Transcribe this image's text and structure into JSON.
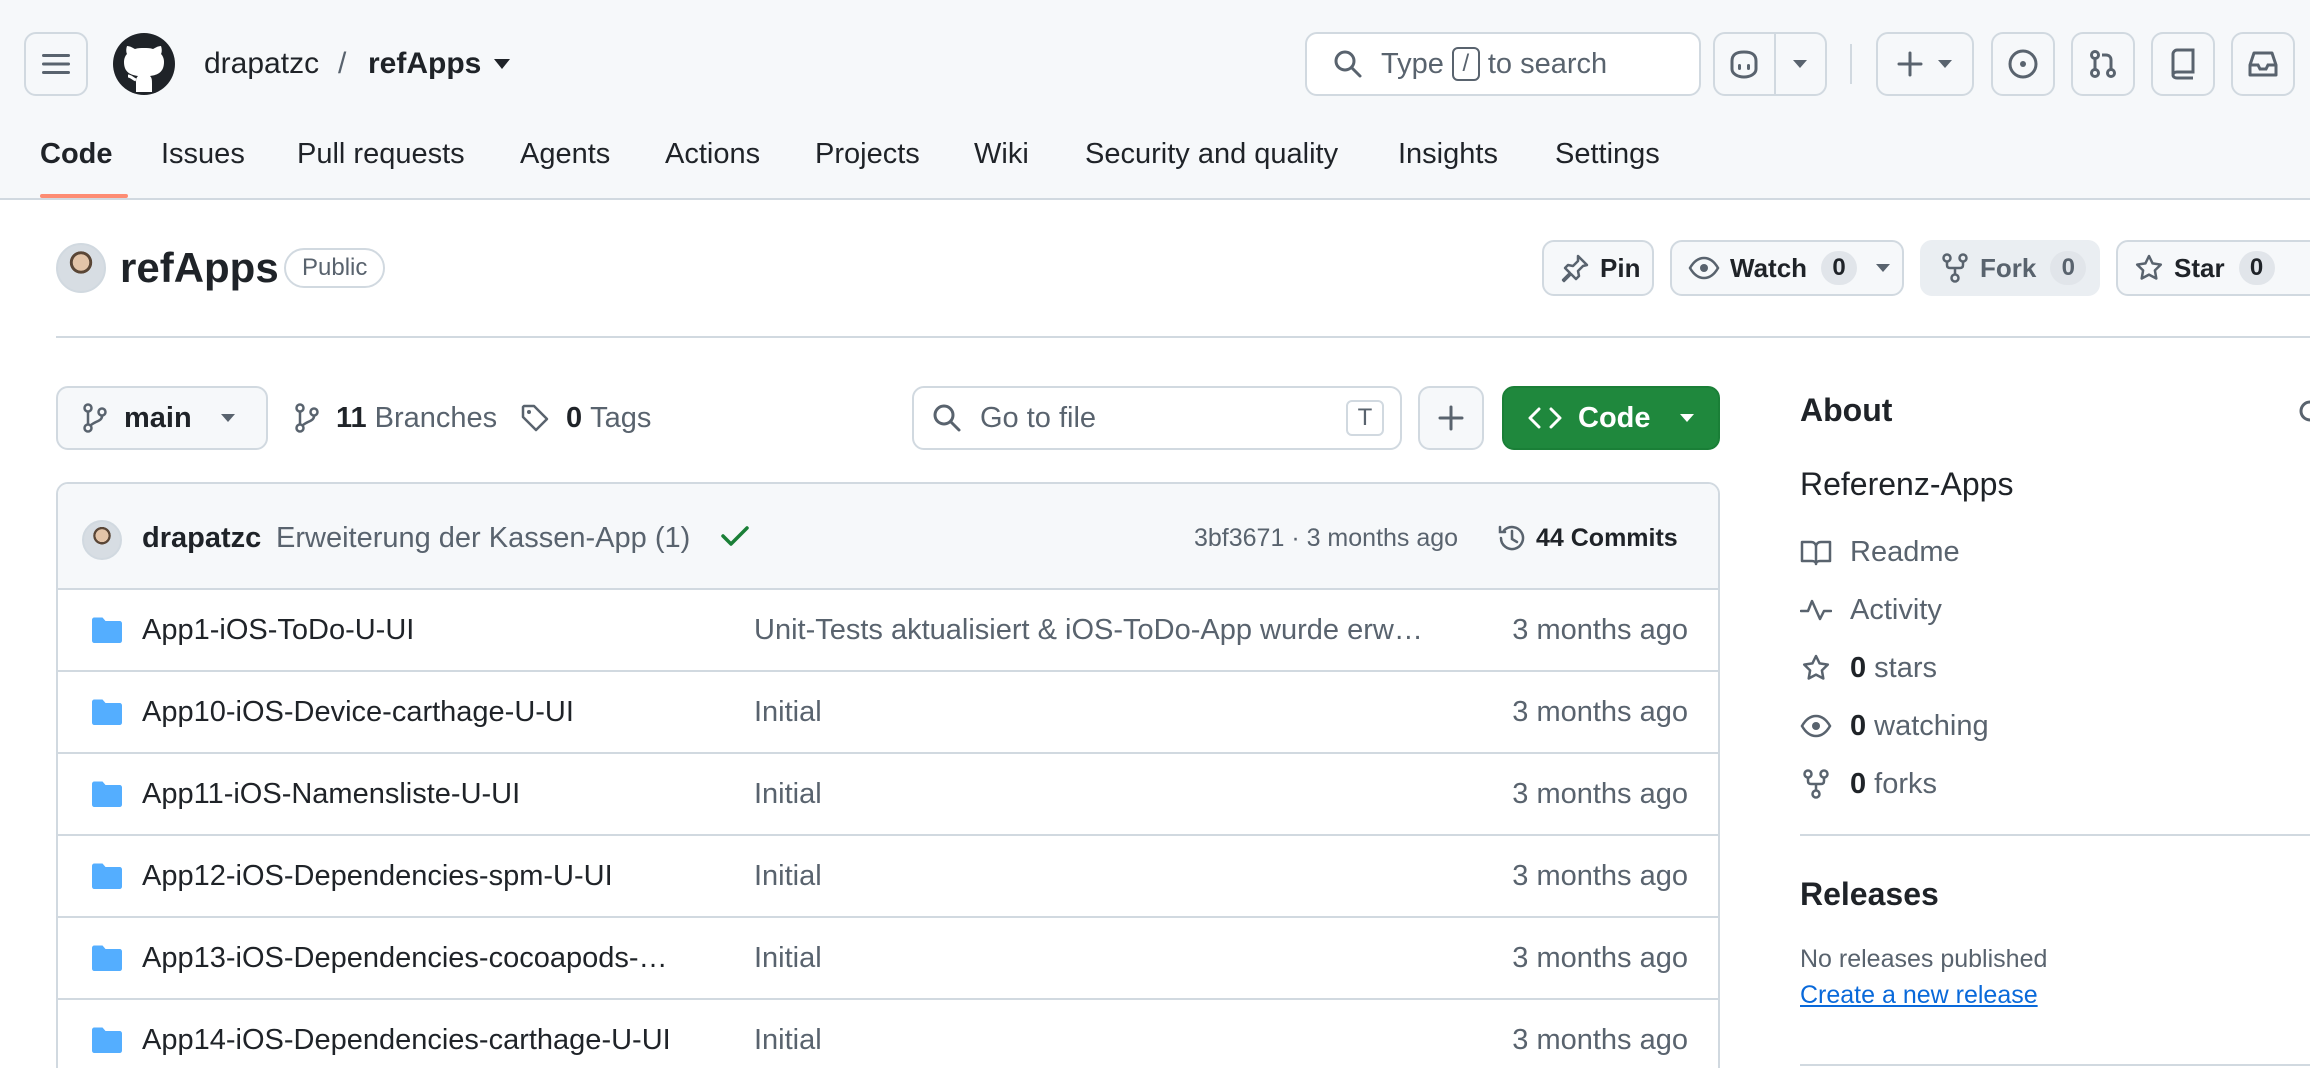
{
  "header": {
    "owner": "drapatzc",
    "separator": "/",
    "repo": "refApps",
    "search_prefix": "Type",
    "search_key": "/",
    "search_suffix": "to search"
  },
  "tabs": [
    {
      "label": "Code"
    },
    {
      "label": "Issues"
    },
    {
      "label": "Pull requests"
    },
    {
      "label": "Agents"
    },
    {
      "label": "Actions"
    },
    {
      "label": "Projects"
    },
    {
      "label": "Wiki"
    },
    {
      "label": "Security and quality"
    },
    {
      "label": "Insights"
    },
    {
      "label": "Settings"
    }
  ],
  "repo_header": {
    "title": "refApps",
    "visibility": "Public",
    "pin_label": "Pin",
    "watch_label": "Watch",
    "watch_count": "0",
    "fork_label": "Fork",
    "fork_count": "0",
    "star_label": "Star",
    "star_count": "0"
  },
  "controls": {
    "branch": "main",
    "branches_count": "11",
    "branches_label": "Branches",
    "tags_count": "0",
    "tags_label": "Tags",
    "goto_placeholder": "Go to file",
    "goto_key": "T",
    "code_label": "Code"
  },
  "commit": {
    "author": "drapatzc",
    "message": "Erweiterung der Kassen-App (1)",
    "hash_time": "3bf3671 · 3 months ago",
    "commits_label": "44 Commits"
  },
  "files": [
    {
      "name": "App1-iOS-ToDo-U-UI",
      "message": "Unit-Tests aktualisiert & iOS-ToDo-App wurde erw…",
      "date": "3 months ago"
    },
    {
      "name": "App10-iOS-Device-carthage-U-UI",
      "message": "Initial",
      "date": "3 months ago"
    },
    {
      "name": "App11-iOS-Namensliste-U-UI",
      "message": "Initial",
      "date": "3 months ago"
    },
    {
      "name": "App12-iOS-Dependencies-spm-U-UI",
      "message": "Initial",
      "date": "3 months ago"
    },
    {
      "name": "App13-iOS-Dependencies-cocoapods-…",
      "message": "Initial",
      "date": "3 months ago"
    },
    {
      "name": "App14-iOS-Dependencies-carthage-U-UI",
      "message": "Initial",
      "date": "3 months ago"
    }
  ],
  "about": {
    "heading": "About",
    "description": "Referenz-Apps",
    "readme": "Readme",
    "activity": "Activity",
    "stars_count": "0",
    "stars_label": "stars",
    "watching_count": "0",
    "watching_label": "watching",
    "forks_count": "0",
    "forks_label": "forks"
  },
  "releases": {
    "heading": "Releases",
    "empty": "No releases published",
    "create_link": "Create a new release"
  },
  "colors": {
    "accent": "#fd8c73",
    "primary_button": "#1f883d",
    "link": "#0969da",
    "folder": "#54aeff",
    "success": "#1a7f37"
  }
}
